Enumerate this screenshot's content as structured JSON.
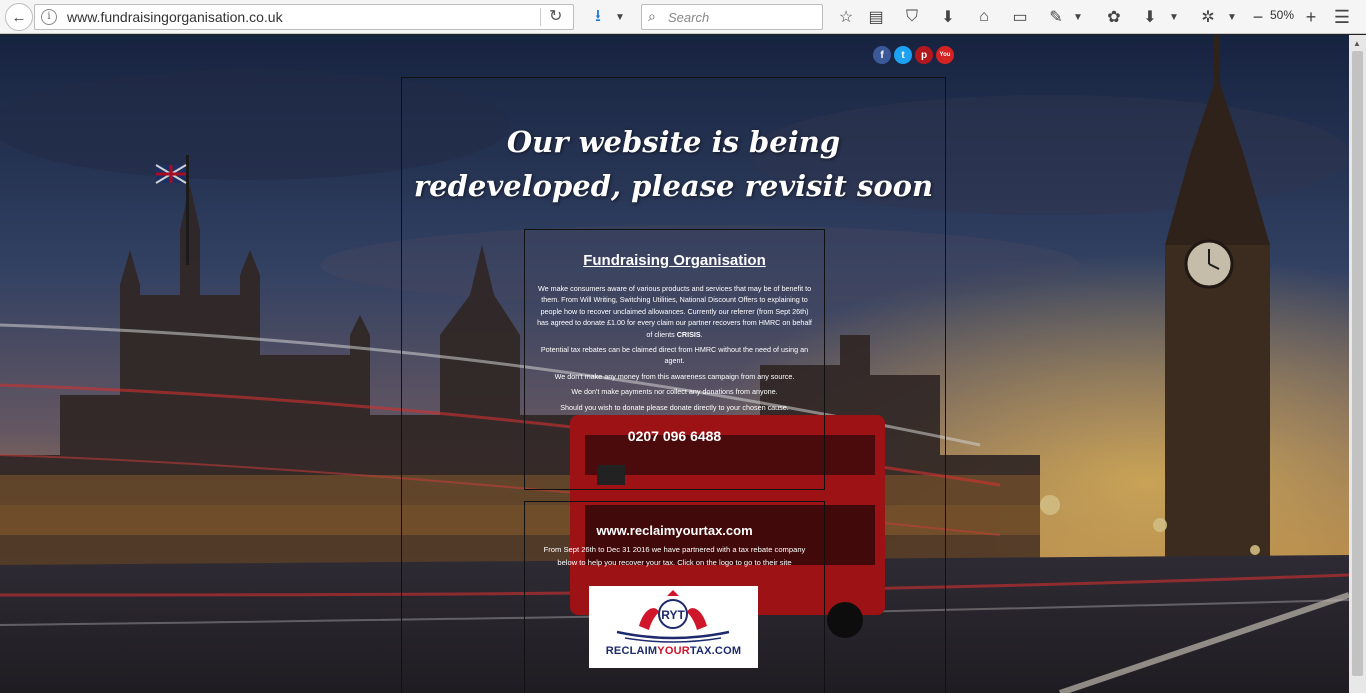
{
  "browser": {
    "url": "www.fundraisingorganisation.co.uk",
    "search_placeholder": "Search",
    "zoom_level": "50%",
    "zoom_minus": "−",
    "zoom_plus": "+"
  },
  "social": [
    {
      "name": "facebook",
      "glyph": "f",
      "color": "#3b5998"
    },
    {
      "name": "twitter",
      "glyph": "t",
      "color": "#1da1f2"
    },
    {
      "name": "pinterest",
      "glyph": "p",
      "color": "#b0181d"
    },
    {
      "name": "youtube",
      "glyph": "You",
      "color": "#d32323"
    }
  ],
  "page": {
    "headline": "Our website is being redeveloped, please revisit soon",
    "org": {
      "title": "Fundraising Organisation",
      "para1_before": "We make consumers aware of various products and services that may be of benefit to them. From Will Writing, Switching Utilities, National Discount Offers to explaining to people how to recover unclaimed allowances. Currently our referrer (from Sept 26th) has agreed to donate £1.00 for every claim our partner recovers from HMRC on behalf of clients ",
      "para1_bold": "CRISIS",
      "para1_after": ".",
      "para2": "Potential tax rebates can be claimed direct from HMRC without the need of using an agent.",
      "para3": "We don't make any money from this awareness campaign from any source.",
      "para4": "We don't make payments nor collect any donations from anyone.",
      "para5": "Should you wish to donate please donate directly to your chosen cause.",
      "phone": "0207 096 6488"
    },
    "partner": {
      "site": "www.reclaimyourtax.com",
      "text": "From Sept 26th to Dec 31 2016 we have partnered with a tax rebate company below to help you recover your tax. Click on the logo to go to their site",
      "logo_initials": "RYT",
      "logo_word_1": "RECLAIM",
      "logo_word_2": "YOUR",
      "logo_word_3": "TAX.COM"
    }
  }
}
